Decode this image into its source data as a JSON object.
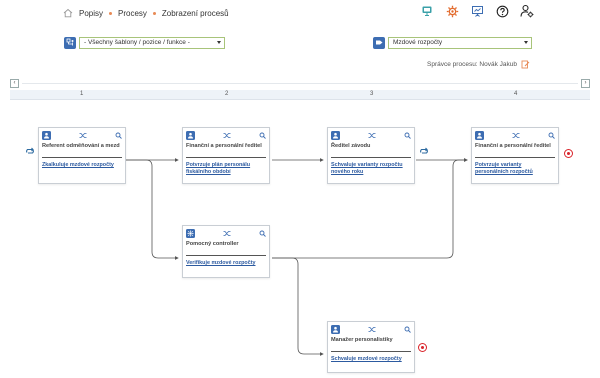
{
  "breadcrumb": {
    "items": [
      "Popisy",
      "Procesy",
      "Zobrazení procesů"
    ]
  },
  "top_icons": [
    "monitor-icon",
    "settings-icon",
    "presentation-icon",
    "help-icon",
    "user-settings-icon"
  ],
  "selectors": {
    "template": {
      "value": "- Všechny šablony / pozice / funkce -"
    },
    "process": {
      "value": "Mzdové rozpočty"
    }
  },
  "manager": {
    "text": "Správce procesu: Novák Jakub"
  },
  "timeline": {
    "columns": [
      "1",
      "2",
      "3",
      "4"
    ]
  },
  "cards": [
    {
      "title": "Referent odměňování a mezd",
      "action": "Zkalkuluje mzdové rozpočty",
      "icon": "person-icon"
    },
    {
      "title": "Finanční a personální ředitel",
      "action": "Potvrzuje plán personálu fiskálního období",
      "icon": "person-icon"
    },
    {
      "title": "Ředitel závodu",
      "action": "Schvaluje varianty rozpočtu nového roku",
      "icon": "person-icon"
    },
    {
      "title": "Finanční a personální ředitel",
      "action": "Potvrzuje varianty personálních rozpočtů",
      "icon": "person-icon"
    },
    {
      "title": "Pomocný controller",
      "action": "Verifikuje mzdové rozpočty",
      "icon": "org-icon"
    },
    {
      "title": "Manažer personalistiky",
      "action": "Schvaluje mzdové rozpočty",
      "icon": "person-icon"
    }
  ],
  "colors": {
    "accent": "#3d6db2",
    "link": "#2c5aa0",
    "end": "#d9232a",
    "orange": "#e88a55",
    "field_border": "#a8c47a"
  }
}
